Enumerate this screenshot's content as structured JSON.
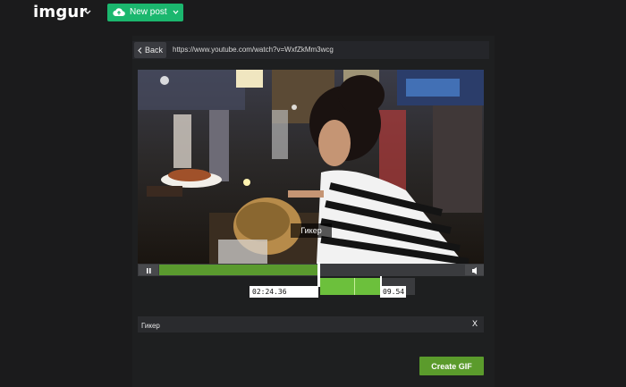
{
  "topbar": {
    "logo": "imgur",
    "new_post_label": "New post"
  },
  "editor": {
    "back_label": "Back",
    "url": "https://www.youtube.com/watch?v=WxfZkMm3wcg",
    "video_caption": "Гикер",
    "start_time": "02:24.36",
    "duration": "09.54",
    "caption_value": "Гикер",
    "caption_clear": "X",
    "create_label": "Create GIF",
    "progress_fraction": 0.47,
    "trim_selected_fraction": 0.64
  },
  "colors": {
    "new_post_green": "#1bb76e",
    "progress_green": "#5a9a2e",
    "trim_green": "#6cc03c",
    "create_green": "#5b9b2c",
    "background": "#1b1b1c"
  }
}
